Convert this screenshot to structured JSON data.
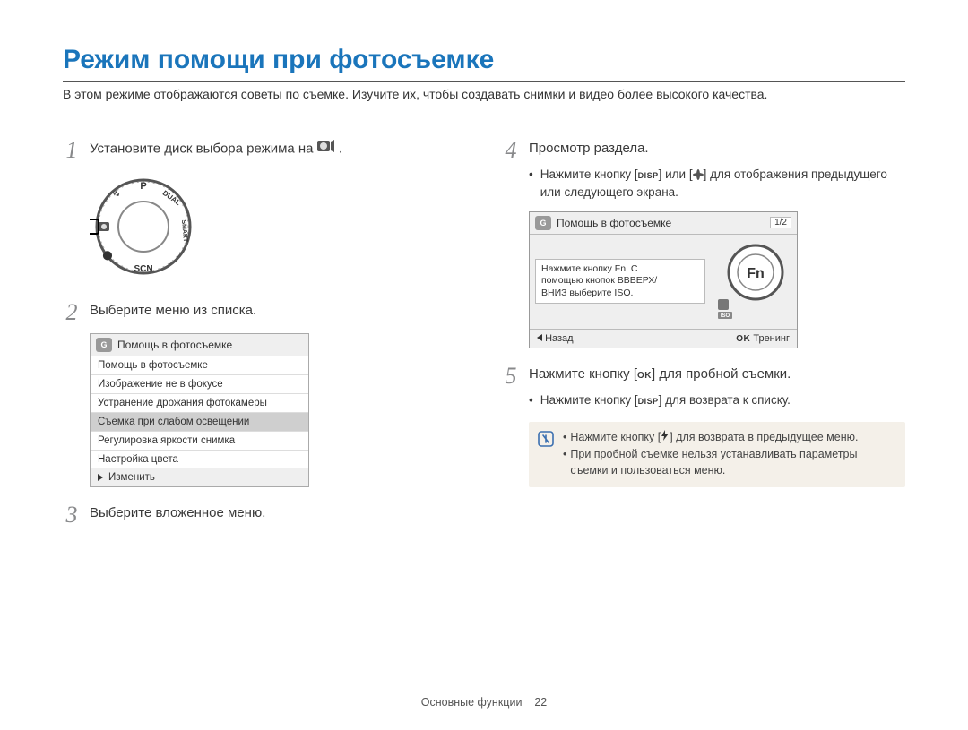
{
  "title": "Режим помощи при фотосъемке",
  "intro": "В этом режиме отображаются советы по съемке. Изучите их, чтобы создавать снимки и видео более высокого качества.",
  "steps": {
    "s1": {
      "num": "1",
      "text_before": "Установите диск выбора режима на ",
      "text_after": "."
    },
    "s2": {
      "num": "2",
      "text": "Выберите меню из списка."
    },
    "s3": {
      "num": "3",
      "text": "Выберите вложенное меню."
    },
    "s4": {
      "num": "4",
      "text": "Просмотр раздела.",
      "bullet_before": "Нажмите кнопку [",
      "bullet_mid": "] или [",
      "bullet_after": "] для отображения предыдущего или следующего экрана."
    },
    "s5": {
      "num": "5",
      "text_before": "Нажмите кнопку [",
      "text_after": "] для пробной съемки.",
      "bullet_before": "Нажмите кнопку [",
      "bullet_after": "] для возврата к списку."
    }
  },
  "menu": {
    "header": "Помощь в фотосъемке",
    "rows": [
      "Помощь в фотосъемке",
      "Изображение не в фокусе",
      "Устранение дрожания фотокамеры",
      "Съемка при слабом освещении",
      "Регулировка яркости снимка",
      "Настройка цвета"
    ],
    "sel_index": 3,
    "footer": "Изменить"
  },
  "screen": {
    "header": "Помощь в фотосъемке",
    "pager": "1/2",
    "lines": [
      "Нажмите кнопку Fn. С",
      "помощью кнопок ВВВЕРХ/",
      "ВНИЗ выберите ISO."
    ],
    "fn": "Fn",
    "iso": "ISO",
    "back": "Назад",
    "ok": "OK",
    "train": "Тренинг"
  },
  "note": {
    "l1_before": "Нажмите кнопку [",
    "l1_after": "] для возврата в предыдущее меню.",
    "l2": "При пробной съемке нельзя устанавливать параметры съемки и пользоваться меню."
  },
  "disp_label": "DISP",
  "ok_label": "OK",
  "footer": {
    "section": "Основные функции",
    "page": "22"
  }
}
